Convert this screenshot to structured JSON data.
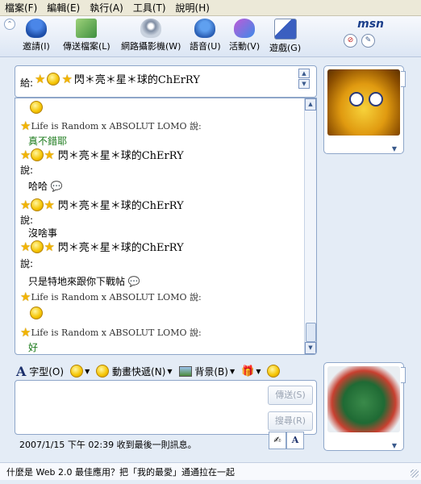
{
  "menu": [
    "檔案(F)",
    "編輯(E)",
    "執行(A)",
    "工具(T)",
    "說明(H)"
  ],
  "toolbar": [
    {
      "label": "邀請(I)",
      "icon": "invite-icon"
    },
    {
      "label": "傳送檔案(L)",
      "icon": "send-file-icon"
    },
    {
      "label": "網路攝影機(W)",
      "icon": "webcam-icon"
    },
    {
      "label": "語音(U)",
      "icon": "voice-icon"
    },
    {
      "label": "活動(V)",
      "icon": "activities-icon"
    },
    {
      "label": "遊戲(G)",
      "icon": "games-icon"
    }
  ],
  "brand": {
    "logo_text": "msn"
  },
  "to": {
    "label": "給:",
    "name": "閃＊亮＊星＊球的ChErRY"
  },
  "messages": [
    {
      "sender": "Life is Random x ABSOLUT LOMO 說:",
      "text": "真不錯耶",
      "color": "green"
    },
    {
      "sender": "閃＊亮＊星＊球的ChErRY",
      "says": "說:",
      "text": "哈哈"
    },
    {
      "sender": "閃＊亮＊星＊球的ChErRY",
      "says": "說:",
      "text": "沒啥事"
    },
    {
      "sender": "閃＊亮＊星＊球的ChErRY",
      "says": "說:",
      "text": "只是特地來跟你下戰帖"
    },
    {
      "sender": "Life is Random x ABSOLUT LOMO 說:",
      "text": ""
    },
    {
      "sender": "Life is Random x ABSOLUT LOMO 說:",
      "text": "好",
      "color": "green"
    }
  ],
  "format": {
    "font": "字型(O)",
    "wink": "動畫快遞(N)",
    "background": "背景(B)"
  },
  "buttons": {
    "send": "傳送(S)",
    "search": "搜尋(R)"
  },
  "status": "2007/1/15 下午 02:39 收到最後一則訊息。",
  "ad": "什麼是 Web 2.0 最佳應用？把「我的最愛」通通拉在一起",
  "colors": {
    "accent": "#1b3f8b",
    "green_text": "#1a7a1a",
    "panel_border": "#8ea6c9"
  }
}
